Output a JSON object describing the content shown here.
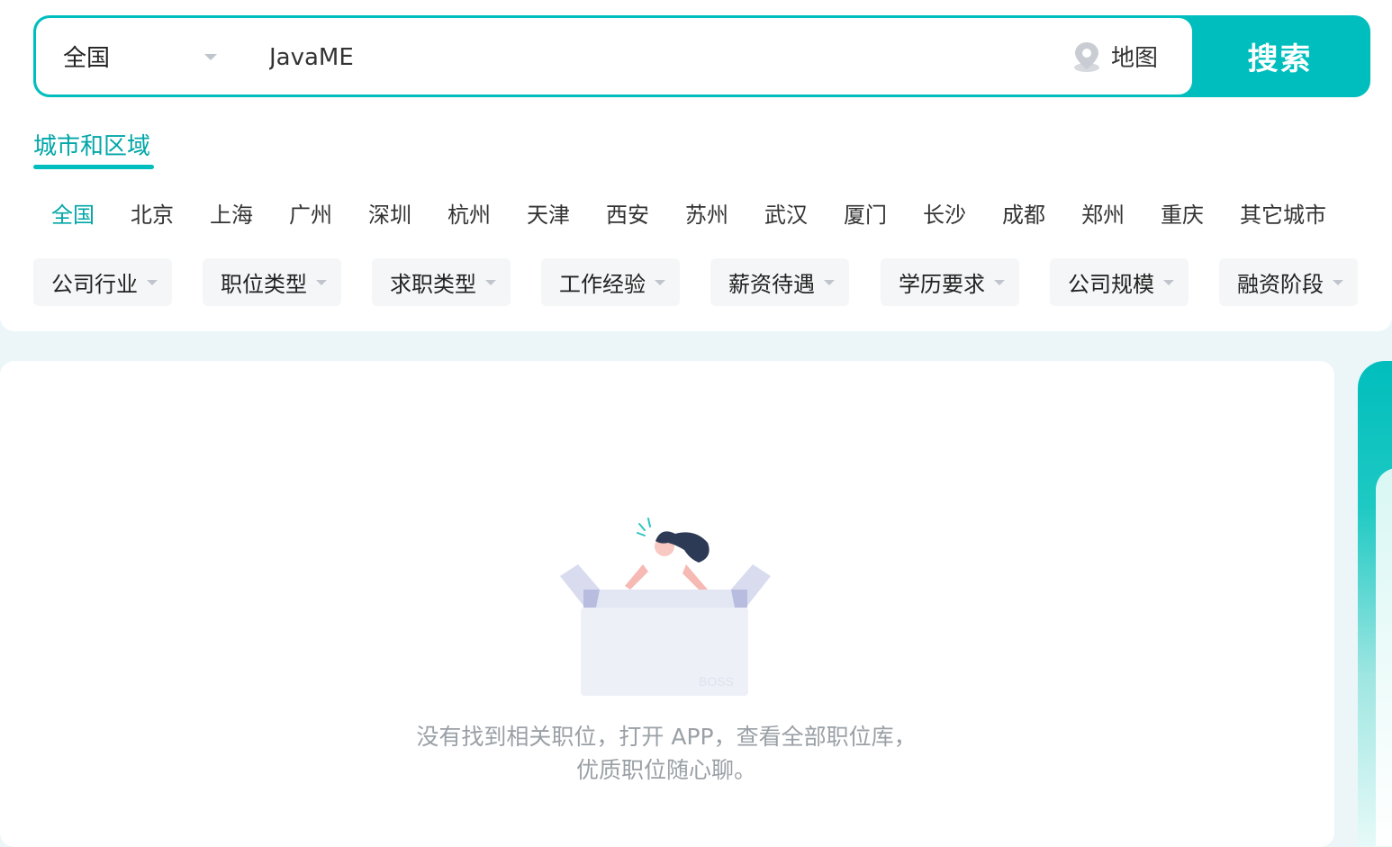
{
  "search": {
    "city": "全国",
    "query": "JavaME",
    "map_label": "地图",
    "button_label": "搜索"
  },
  "region_tab": "城市和区域",
  "cities": [
    {
      "label": "全国",
      "active": true
    },
    {
      "label": "北京"
    },
    {
      "label": "上海"
    },
    {
      "label": "广州"
    },
    {
      "label": "深圳"
    },
    {
      "label": "杭州"
    },
    {
      "label": "天津"
    },
    {
      "label": "西安"
    },
    {
      "label": "苏州"
    },
    {
      "label": "武汉"
    },
    {
      "label": "厦门"
    },
    {
      "label": "长沙"
    },
    {
      "label": "成都"
    },
    {
      "label": "郑州"
    },
    {
      "label": "重庆"
    },
    {
      "label": "其它城市"
    }
  ],
  "filters": [
    "公司行业",
    "职位类型",
    "求职类型",
    "工作经验",
    "薪资待遇",
    "学历要求",
    "公司规模",
    "融资阶段"
  ],
  "empty_state": {
    "box_text": "BOSS",
    "line1": "没有找到相关职位，打开 APP，查看全部职位库，",
    "line2": "优质职位随心聊。"
  },
  "colors": {
    "accent": "#00bebd",
    "accent_text": "#00a6a7"
  }
}
